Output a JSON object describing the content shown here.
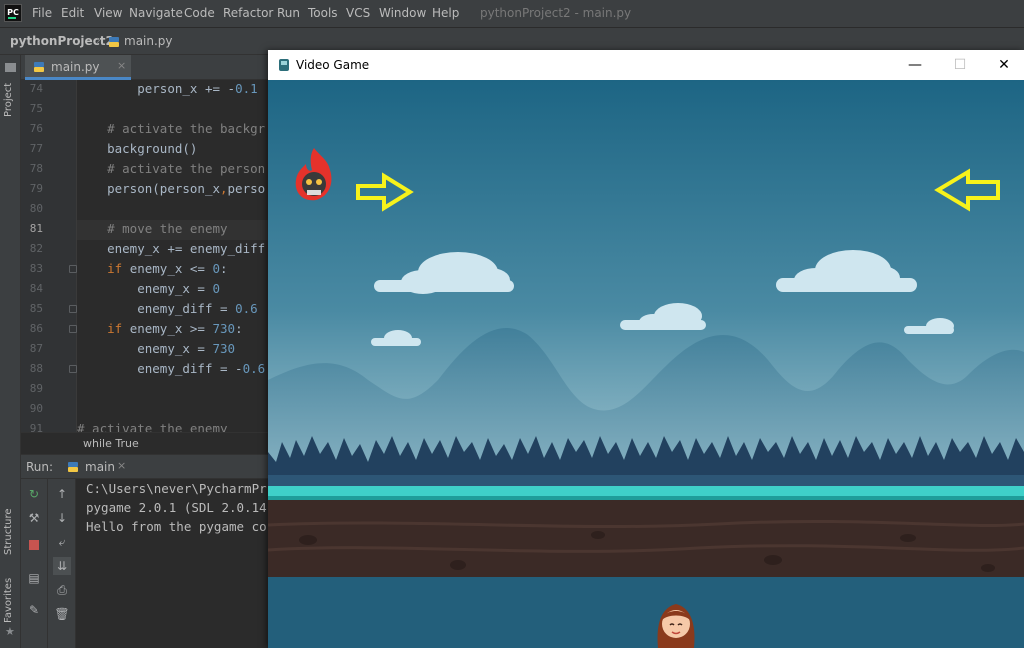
{
  "ide": {
    "logo_text": "PC",
    "menu": [
      "File",
      "Edit",
      "View",
      "Navigate",
      "Code",
      "Refactor",
      "Run",
      "Tools",
      "VCS",
      "Window",
      "Help"
    ],
    "window_title": "pythonProject2 - main.py",
    "breadcrumb": {
      "project": "pythonProject2",
      "file": "main.py"
    },
    "left_strip": {
      "project": "Project",
      "structure": "Structure",
      "favorites": "Favorites"
    }
  },
  "editor": {
    "tab_label": "main.py",
    "tab_close": "×",
    "current_line": 81,
    "lines": [
      {
        "num": "74",
        "indent": "        ",
        "parts": [
          [
            "person_x += -",
            "txt"
          ],
          [
            "0.1",
            "num"
          ]
        ]
      },
      {
        "num": "75",
        "indent": "",
        "parts": []
      },
      {
        "num": "76",
        "indent": "    ",
        "parts": [
          [
            "# activate the backgr",
            "cmt"
          ]
        ]
      },
      {
        "num": "77",
        "indent": "    ",
        "parts": [
          [
            "background()",
            "txt"
          ]
        ]
      },
      {
        "num": "78",
        "indent": "    ",
        "parts": [
          [
            "# activate the person",
            "cmt"
          ]
        ]
      },
      {
        "num": "79",
        "indent": "    ",
        "parts": [
          [
            "person(person_x",
            "txt"
          ],
          [
            ",",
            "kw"
          ],
          [
            "perso",
            "txt"
          ]
        ]
      },
      {
        "num": "80",
        "indent": "",
        "parts": []
      },
      {
        "num": "81",
        "indent": "    ",
        "parts": [
          [
            "# move the enemy",
            "cmt"
          ]
        ]
      },
      {
        "num": "82",
        "indent": "    ",
        "parts": [
          [
            "enemy_x += enemy_diff",
            "txt"
          ]
        ]
      },
      {
        "num": "83",
        "indent": "    ",
        "parts": [
          [
            "if ",
            "kw"
          ],
          [
            "enemy_x <= ",
            "txt"
          ],
          [
            "0",
            "num"
          ],
          [
            ":",
            "txt"
          ]
        ]
      },
      {
        "num": "84",
        "indent": "        ",
        "parts": [
          [
            "enemy_x = ",
            "txt"
          ],
          [
            "0",
            "num"
          ]
        ]
      },
      {
        "num": "85",
        "indent": "        ",
        "parts": [
          [
            "enemy_diff = ",
            "txt"
          ],
          [
            "0.6",
            "num"
          ]
        ]
      },
      {
        "num": "86",
        "indent": "    ",
        "parts": [
          [
            "if ",
            "kw"
          ],
          [
            "enemy_x >= ",
            "txt"
          ],
          [
            "730",
            "num"
          ],
          [
            ":",
            "txt"
          ]
        ]
      },
      {
        "num": "87",
        "indent": "        ",
        "parts": [
          [
            "enemy_x = ",
            "txt"
          ],
          [
            "730",
            "num"
          ]
        ]
      },
      {
        "num": "88",
        "indent": "        ",
        "parts": [
          [
            "enemy_diff = -",
            "txt"
          ],
          [
            "0.6",
            "num"
          ]
        ]
      },
      {
        "num": "89",
        "indent": "",
        "parts": []
      },
      {
        "num": "90",
        "indent": "",
        "parts": []
      },
      {
        "num": "91",
        "indent": "",
        "parts": [
          [
            "# activate the enemy",
            "cmt"
          ]
        ]
      }
    ],
    "breadcrumb": "while True"
  },
  "run": {
    "label": "Run:",
    "tab_label": "main",
    "tab_close": "×",
    "console": [
      "C:\\Users\\never\\PycharmPr",
      "pygame 2.0.1 (SDL 2.0.14",
      "Hello from the pygame co"
    ]
  },
  "game_window": {
    "title": "Video Game",
    "minimize": "—",
    "maximize": "☐",
    "close": "✕"
  },
  "colors": {
    "sky": "#1f6584",
    "grass": "#3fd0c9",
    "dirt": "#3b2a26",
    "water": "#235f7b",
    "arrow": "#f7f21b",
    "enemy_flame": "#e5322b"
  }
}
